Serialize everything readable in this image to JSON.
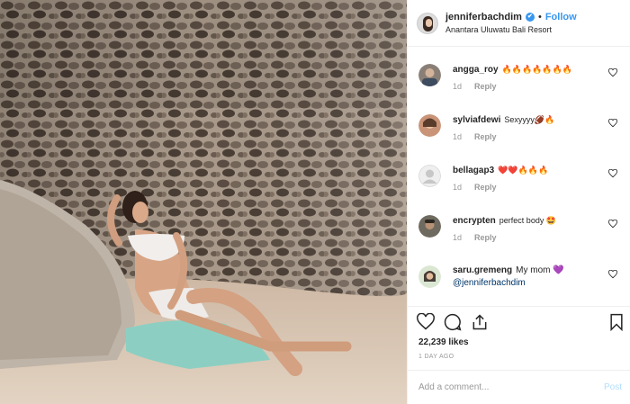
{
  "header": {
    "username": "jenniferbachdim",
    "verified_glyph": "✔",
    "separator": "•",
    "follow_label": "Follow",
    "location": "Anantara Uluwatu Bali Resort"
  },
  "comments": [
    {
      "user": "angga_roy",
      "text": "🔥🔥🔥🔥🔥🔥🔥",
      "age": "1d",
      "reply_label": "Reply",
      "avatar": "avatar-photo"
    },
    {
      "user": "sylviafdewi",
      "text": "Sexyyyy🏈🔥",
      "age": "1d",
      "reply_label": "Reply",
      "avatar": "avatar-photo"
    },
    {
      "user": "bellagap3",
      "text": "❤️❤️🔥🔥🔥",
      "age": "1d",
      "reply_label": "Reply",
      "avatar": "default-avatar"
    },
    {
      "user": "encrypten",
      "text": "perfect body 🤩",
      "age": "1d",
      "reply_label": "Reply",
      "avatar": "avatar-photo"
    },
    {
      "user": "saru.gremeng",
      "text": "My mom 💜",
      "mention": "@jenniferbachdim",
      "avatar": "avatar-photo"
    }
  ],
  "actions": {
    "icons": [
      "heart-icon",
      "comment-icon",
      "share-icon",
      "bookmark-icon"
    ]
  },
  "likes": "22,239 likes",
  "timestamp": "1 DAY AGO",
  "add_comment": {
    "placeholder": "Add a comment...",
    "post_label": "Post"
  },
  "colors": {
    "link_blue": "#3897f0",
    "post_disabled": "#b2dffc",
    "meta_gray": "#999999",
    "border": "#efefef"
  }
}
